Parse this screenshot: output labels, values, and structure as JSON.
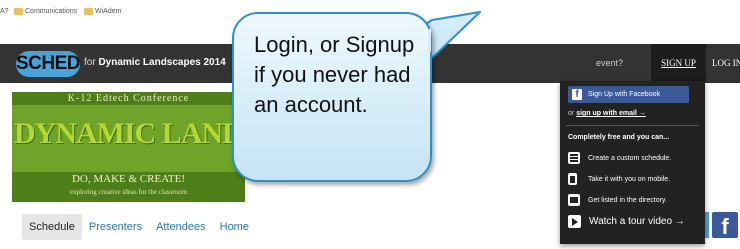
{
  "bookmarks": {
    "items": [
      {
        "label": "A?"
      },
      {
        "label": "Communications"
      },
      {
        "label": "WiAdem"
      }
    ]
  },
  "navbar": {
    "logo_text": "SCHED",
    "event_prefix": "for",
    "event_name": "Dynamic Landscapes 2014",
    "event_question": "event?",
    "signup_label": "SIGN UP",
    "login_label": "LOG IN"
  },
  "banner": {
    "top_line": "K-12 Edtech Conference",
    "main_text": "DYNAMIC LANDSCAPES",
    "tagline": "DO, MAKE & CREATE!",
    "subtagline": "exploring creative ideas for the classroom"
  },
  "callout": {
    "text": "Login, or Signup if you never had an account."
  },
  "dropdown": {
    "facebook_button": "Sign Up with Facebook",
    "email_prefix": "or",
    "email_link": "sign up with email →",
    "free_line": "Completely free and you can...",
    "features": [
      {
        "icon": "list-icon",
        "label": "Create a custom schedule."
      },
      {
        "icon": "phone-icon",
        "label": "Take it with you on mobile."
      },
      {
        "icon": "id-card-icon",
        "label": "Get listed in the directory."
      },
      {
        "icon": "video-icon",
        "label": "Watch a tour video →"
      }
    ]
  },
  "tabs": [
    {
      "label": "Schedule",
      "active": true
    },
    {
      "label": "Presenters",
      "active": false
    },
    {
      "label": "Attendees",
      "active": false
    },
    {
      "label": "Home",
      "active": false
    }
  ],
  "colors": {
    "navbar": "#333333",
    "callout_border": "#2e8fc9",
    "facebook": "#3b5998",
    "banner_green": "#6fa329",
    "link_blue": "#2a7ab0"
  }
}
